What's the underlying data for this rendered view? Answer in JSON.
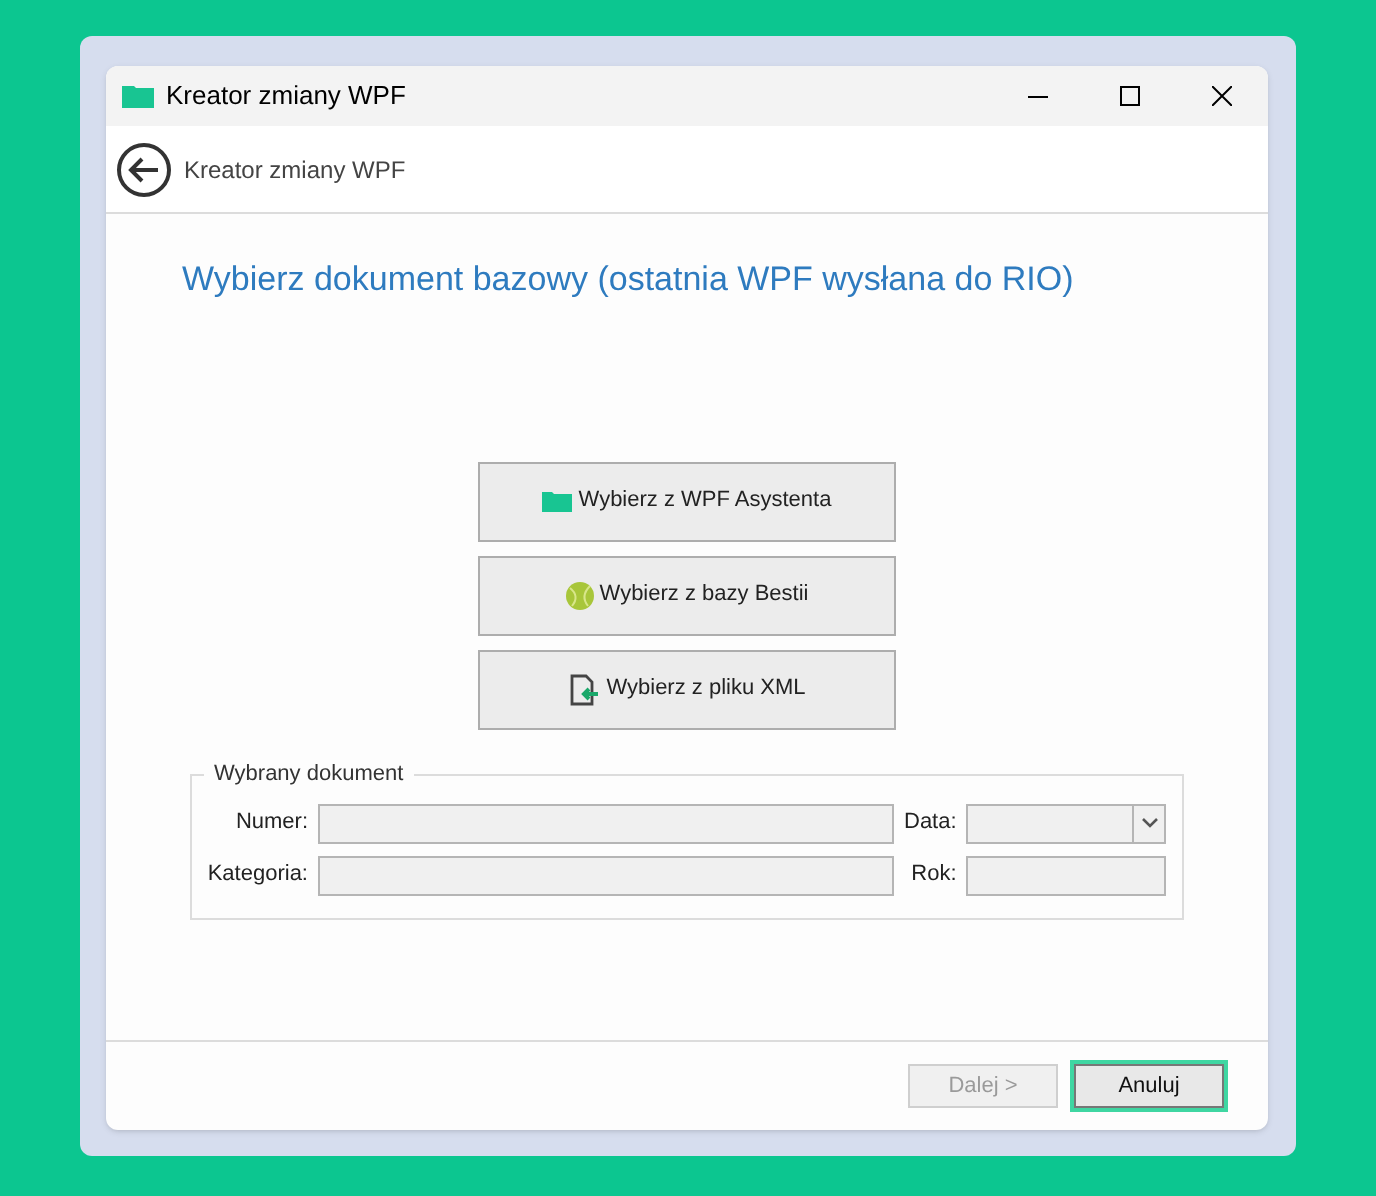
{
  "window": {
    "title": "Kreator zmiany WPF"
  },
  "header": {
    "title": "Kreator zmiany WPF"
  },
  "heading": "Wybierz dokument bazowy (ostatnia WPF wysłana do RIO)",
  "options": [
    {
      "kind": "folder",
      "label": "Wybierz z WPF Asystenta"
    },
    {
      "kind": "ball",
      "label": "Wybierz z bazy Bestii"
    },
    {
      "kind": "import",
      "label": "Wybierz z pliku XML"
    }
  ],
  "group": {
    "title": "Wybrany dokument",
    "fields": [
      {
        "kind": "text",
        "label": "Numer:"
      },
      {
        "kind": "dropdown",
        "label": "Data:"
      },
      {
        "kind": "text",
        "label": "Kategoria:"
      },
      {
        "kind": "text",
        "label": "Rok:"
      }
    ]
  },
  "footer": {
    "buttons": [
      {
        "label": "Dalej >",
        "disabled": true,
        "focused": false
      },
      {
        "label": "Anuluj",
        "disabled": false,
        "focused": true
      }
    ]
  }
}
